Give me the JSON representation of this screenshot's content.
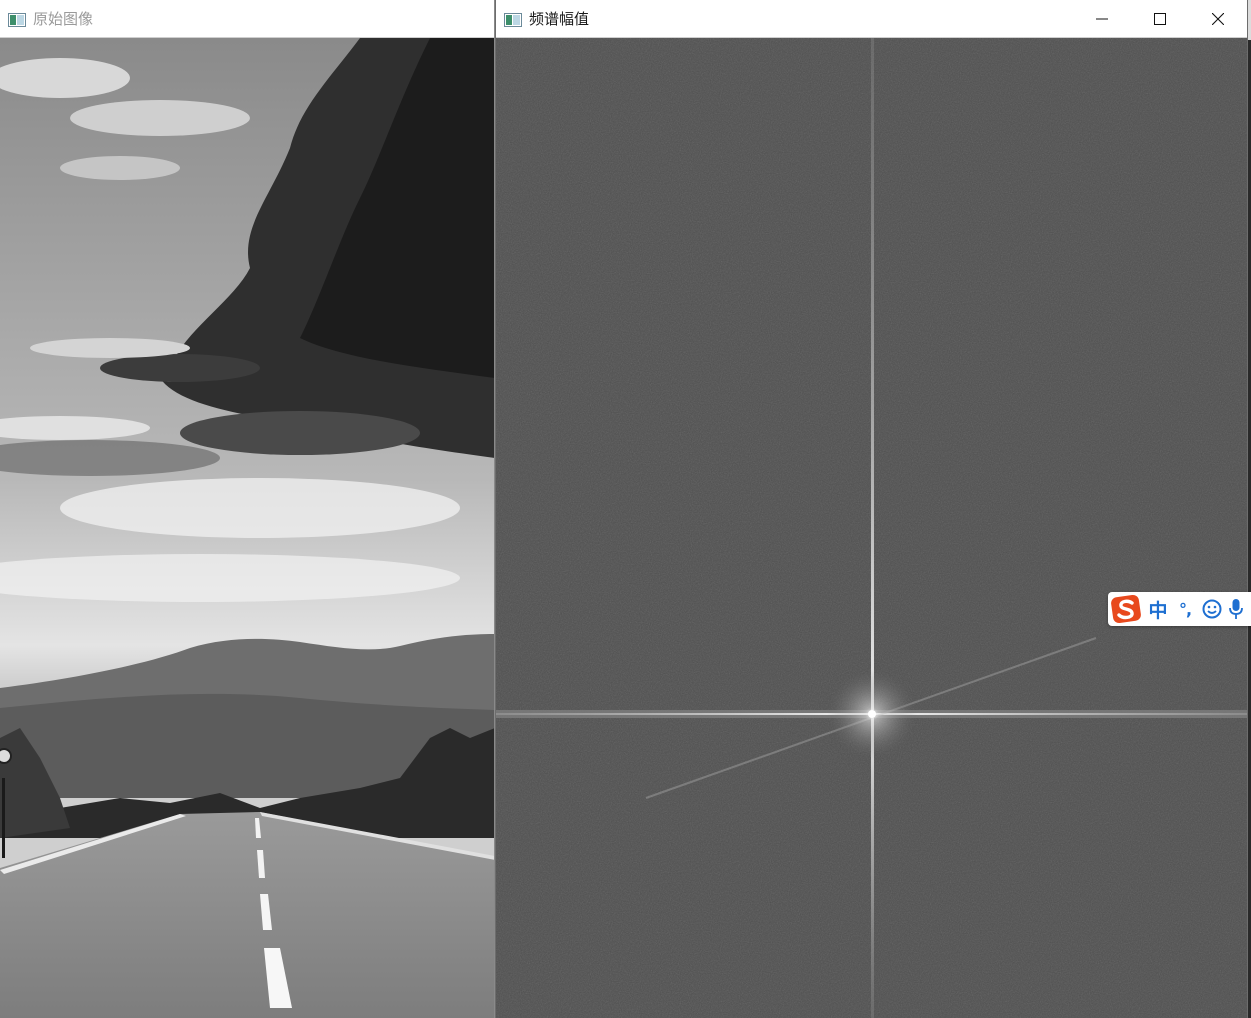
{
  "windows": {
    "original": {
      "title": "原始图像"
    },
    "spectrum": {
      "title": "频谱幅值"
    }
  },
  "ime": {
    "mode_label": "中",
    "punct_label": "°,"
  },
  "icons": {
    "app": "window-app-icon",
    "minimize": "minimize-icon",
    "maximize": "maximize-icon",
    "close": "close-icon",
    "ime_logo": "sogou-logo-icon",
    "emoji": "smiley-icon",
    "voice": "microphone-icon"
  },
  "colors": {
    "ime_accent": "#1e6fd1",
    "ime_logo": "#e8491d"
  }
}
